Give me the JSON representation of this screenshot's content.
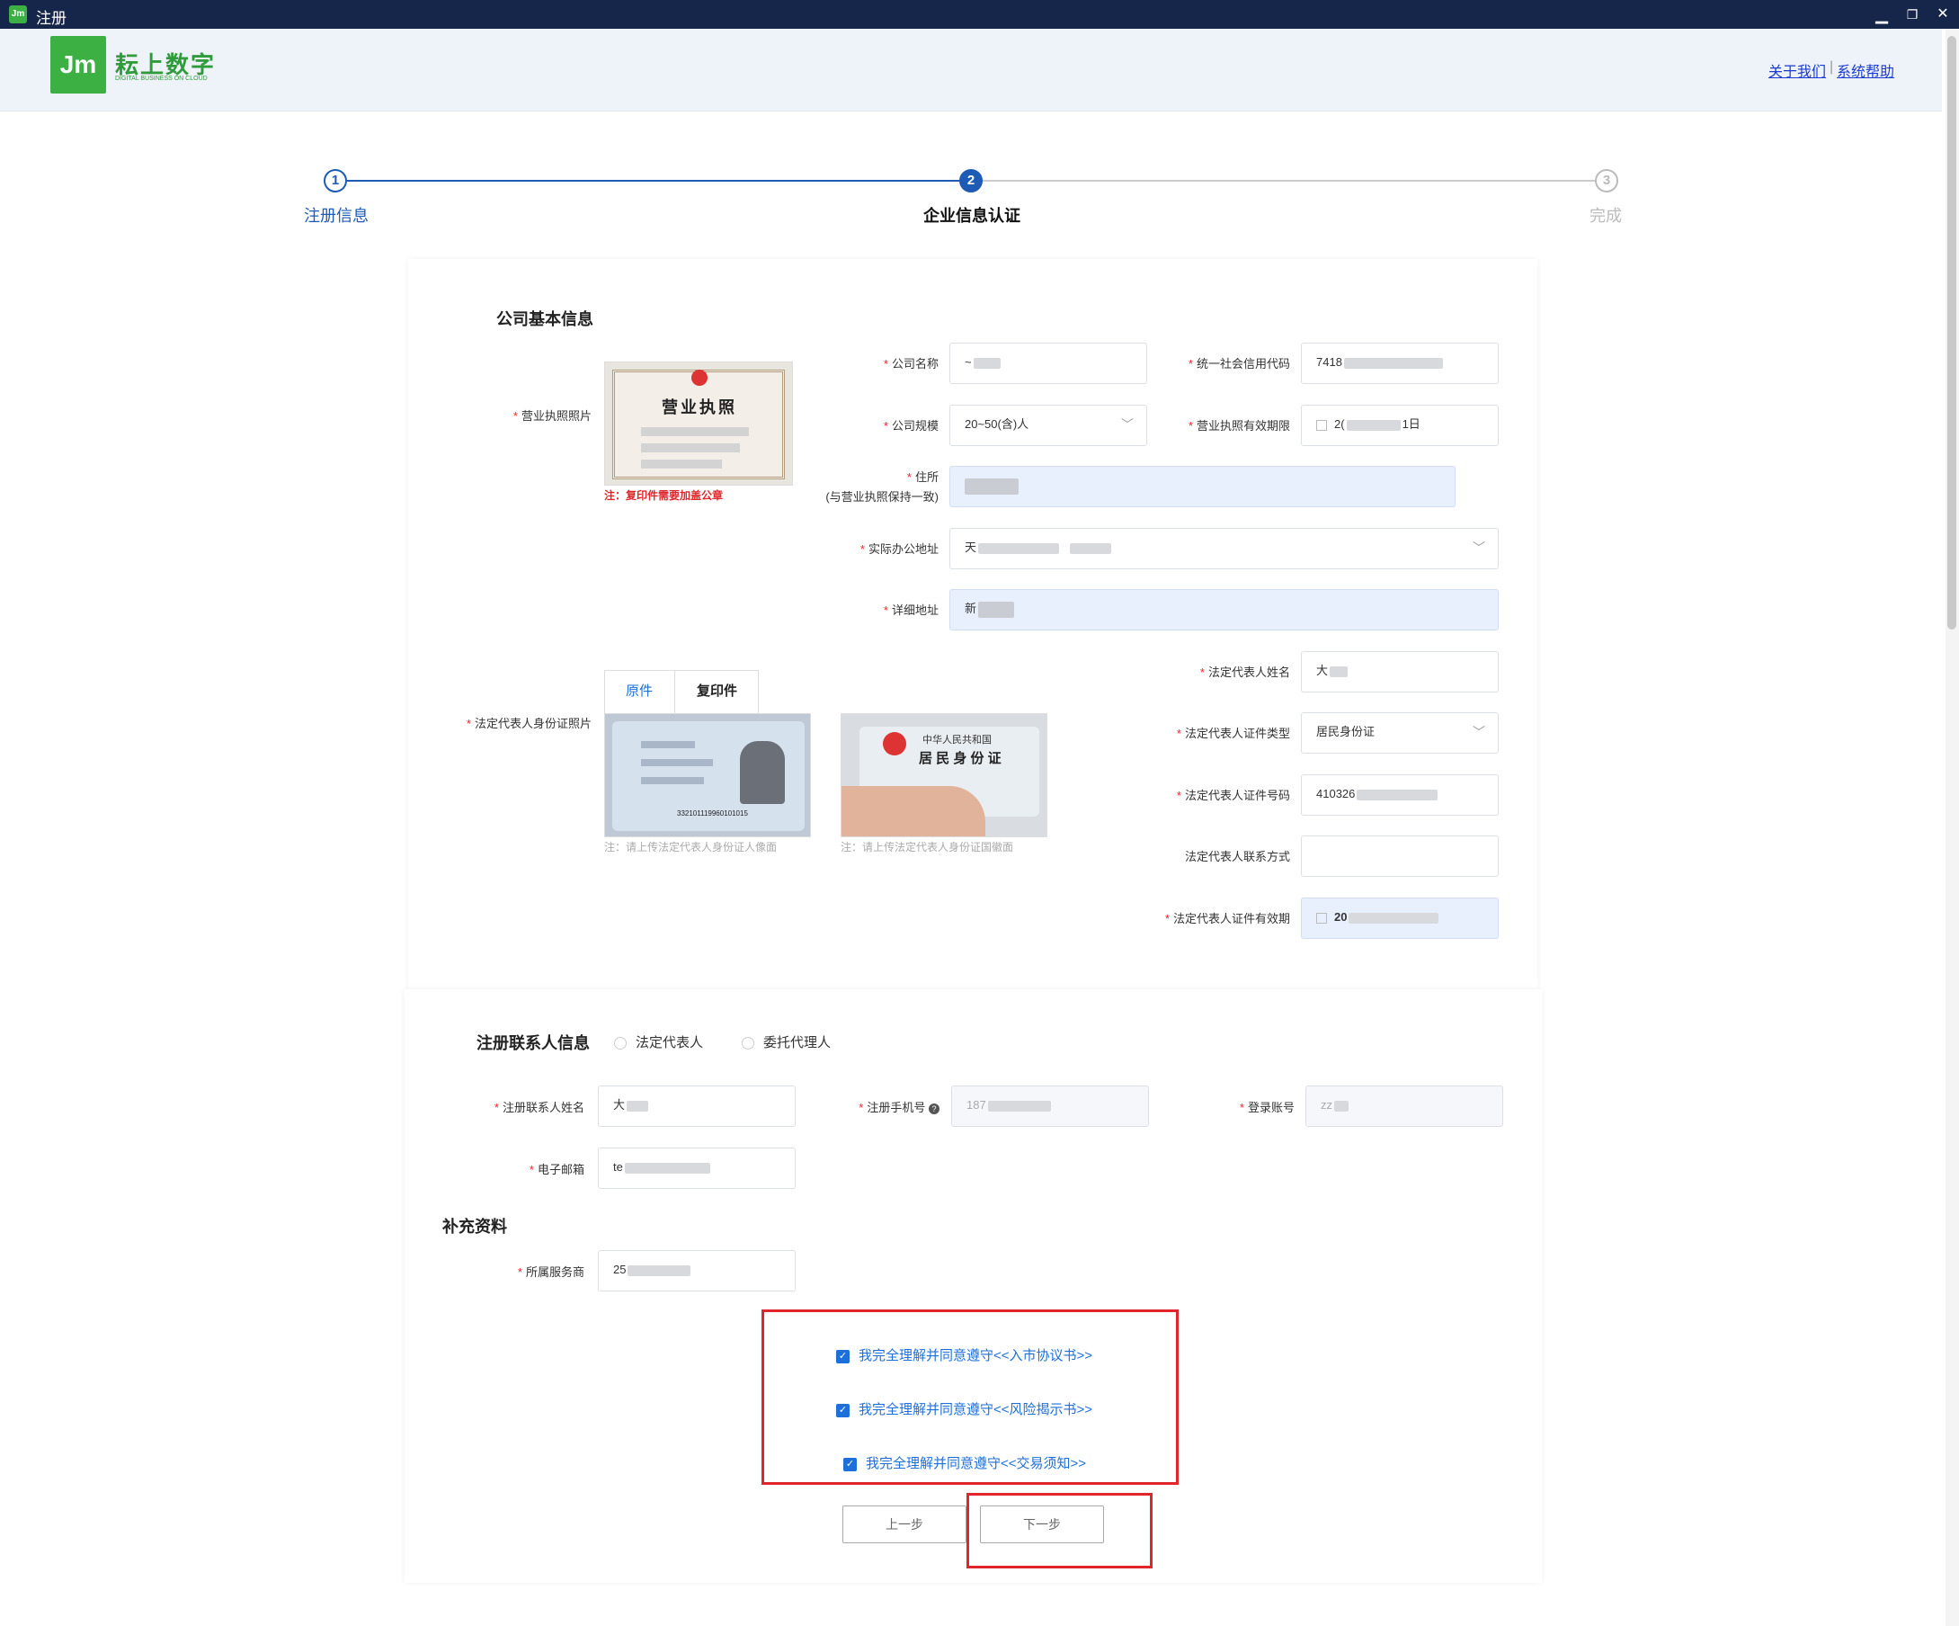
{
  "window": {
    "title": "注册",
    "minimize": "▁",
    "restore": "❐",
    "close": "✕"
  },
  "header": {
    "logo_mark": "Jm",
    "logo_cn": "耘上数字",
    "logo_en": "DIGITAL BUSINESS ON CLOUD",
    "about": "关于我们",
    "separator": "|",
    "help": "系统帮助"
  },
  "steps": [
    {
      "num": "1",
      "label": "注册信息",
      "state": "done"
    },
    {
      "num": "2",
      "label": "企业信息认证",
      "state": "active"
    },
    {
      "num": "3",
      "label": "完成",
      "state": "pending"
    }
  ],
  "company": {
    "section_title": "公司基本信息",
    "license_photo_label": "营业执照照片",
    "license_title": "营业执照",
    "license_note": "注：复印件需要加盖公章",
    "name_label": "公司名称",
    "name_value": "~",
    "credit_code_label": "统一社会信用代码",
    "credit_code_value": "7418",
    "scale_label": "公司规模",
    "scale_value": "20~50(含)人",
    "license_validity_label": "营业执照有效期限",
    "license_validity_value_start": "2(",
    "license_validity_value_end": "1日",
    "address_label": "住所",
    "address_sub": "(与营业执照保持一致)",
    "office_label": "实际办公地址",
    "office_value": "天",
    "detail_label": "详细地址",
    "detail_value": "新"
  },
  "legal": {
    "id_photo_label": "法定代表人身份证照片",
    "tab_original": "原件",
    "tab_copy": "复印件",
    "id_card_front_heading": "中华人民共和国",
    "id_card_front_title": "居 民 身 份 证",
    "id_card_number_sample": "332101119960101015",
    "note_front": "注：请上传法定代表人身份证人像面",
    "note_back": "注：请上传法定代表人身份证国徽面",
    "name_label": "法定代表人姓名",
    "name_value": "大",
    "id_type_label": "法定代表人证件类型",
    "id_type_value": "居民身份证",
    "id_number_label": "法定代表人证件号码",
    "id_number_value": "410326",
    "contact_label": "法定代表人联系方式",
    "contact_value": "",
    "id_validity_label": "法定代表人证件有效期",
    "id_validity_value": "20"
  },
  "contact": {
    "section_title": "注册联系人信息",
    "radio_legal": "法定代表人",
    "radio_agent": "委托代理人",
    "name_label": "注册联系人姓名",
    "name_value": "大",
    "phone_label": "注册手机号",
    "phone_help": "?",
    "phone_value": "187",
    "account_label": "登录账号",
    "account_value": "zz",
    "email_label": "电子邮箱",
    "email_value": "te"
  },
  "supplement": {
    "section_title": "补充资料",
    "provider_label": "所属服务商",
    "provider_value": "25"
  },
  "agreements": [
    {
      "prefix": "我完全理解并同意遵守",
      "doc": "<<入市协议书>>",
      "checked": true
    },
    {
      "prefix": "我完全理解并同意遵守",
      "doc": "<<风险揭示书>>",
      "checked": true
    },
    {
      "prefix": "我完全理解并同意遵守",
      "doc": "<<交易须知>>",
      "checked": true
    }
  ],
  "buttons": {
    "prev": "上一步",
    "next": "下一步"
  },
  "colors": {
    "primary": "#1e6fd9",
    "title_bar": "#15264a",
    "logo_green": "#3cb043",
    "highlight_red": "#e0262a"
  }
}
